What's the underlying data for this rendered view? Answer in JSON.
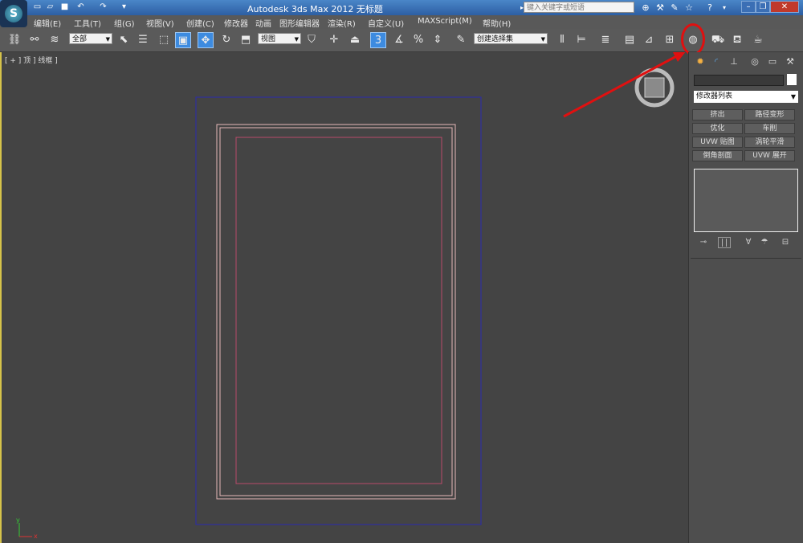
{
  "app": {
    "logo_letter": "S",
    "title": "Autodesk 3ds Max  2012        无标题",
    "search_placeholder": "键入关键字或短语"
  },
  "quick_access": {
    "icons": [
      "new-file-icon",
      "open-folder-icon",
      "save-icon",
      "undo-icon",
      "redo-icon",
      "dropdown-icon"
    ]
  },
  "menu": {
    "items": [
      "编辑(E)",
      "工具(T)",
      "组(G)",
      "视图(V)",
      "创建(C)",
      "修改器",
      "动画",
      "图形编辑器",
      "渲染(R)",
      "自定义(U)",
      "MAXScript(M)",
      "帮助(H)"
    ]
  },
  "toolbar": {
    "selection_filter": "全部",
    "reference_coord": "视图",
    "named_selection": "创建选择集",
    "snap_label": "3"
  },
  "viewport": {
    "label": "[ + ] 顶 ] 线框 ]",
    "axis_y": "y",
    "axis_x": "x"
  },
  "command_panel": {
    "modifier_list": "修改器列表",
    "buttons": [
      "挤出",
      "路径变形",
      "优化",
      "车削",
      "UVW 贴图",
      "涡轮平滑",
      "倒角剖面",
      "UVW 展开"
    ]
  },
  "colors": {
    "title_bar": "#3a74bd",
    "viewport_bg": "#444444",
    "viewport_border": "#d6c34a",
    "highlight": "#e01010",
    "frame_outer": "#2a2ab0",
    "frame_pink": "#e6b9b9",
    "frame_inner": "#b84a6a"
  }
}
